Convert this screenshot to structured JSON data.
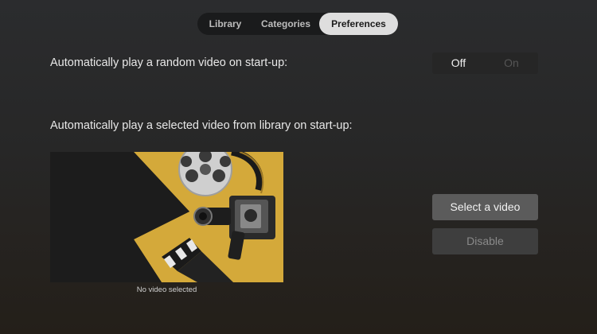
{
  "tabs": [
    {
      "label": "Library",
      "selected": false
    },
    {
      "label": "Categories",
      "selected": false
    },
    {
      "label": "Preferences",
      "selected": true
    }
  ],
  "settings": {
    "random_video_label": "Automatically play a random video on start-up:",
    "random_video_toggle": {
      "off_label": "Off",
      "on_label": "On",
      "value": "Off"
    },
    "selected_video_label": "Automatically play a selected video from library on start-up:",
    "preview": {
      "image": "vintage-film-camera-reel-clapperboard",
      "caption": "No video selected"
    },
    "select_button_label": "Select a video",
    "disable_button_label": "Disable"
  },
  "colors": {
    "background": "#2a2a2a",
    "tab_active_bg": "#dedede",
    "button_bg": "#5b5b5b",
    "disabled_button_bg": "#3e3e3e",
    "preview_yellow": "#d4a93a"
  }
}
